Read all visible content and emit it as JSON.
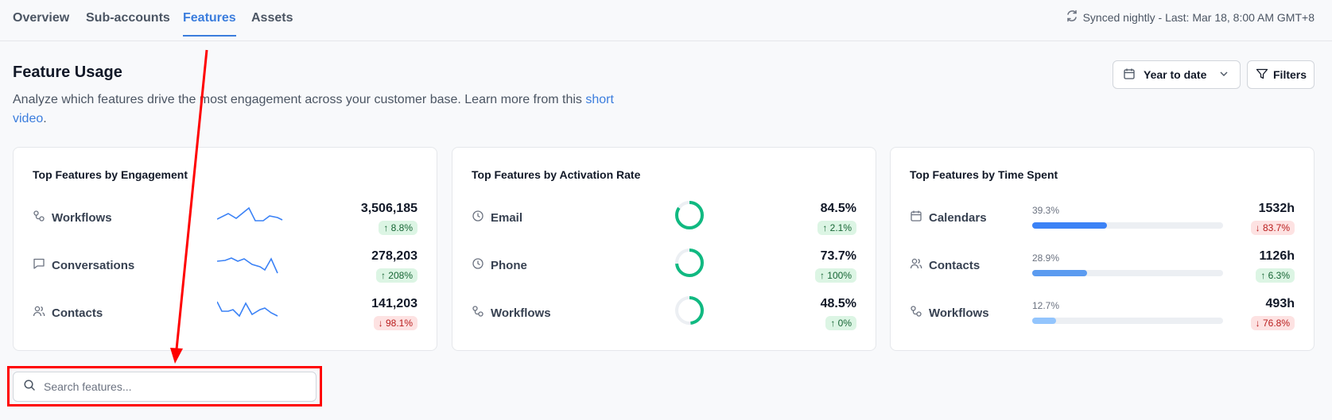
{
  "nav": {
    "tabs": [
      {
        "label": "Overview"
      },
      {
        "label": "Sub-accounts"
      },
      {
        "label": "Features"
      },
      {
        "label": "Assets"
      }
    ],
    "sync_text": "Synced nightly - Last: Mar 18, 8:00 AM GMT+8"
  },
  "header": {
    "title": "Feature Usage",
    "description": "Analyze which features drive the most engagement across your customer base. Learn more from this ",
    "link_text": "short video",
    "period": ".",
    "date_range": "Year to date",
    "filters_label": "Filters"
  },
  "cards": {
    "engagement": {
      "title": "Top Features by Engagement",
      "rows": [
        {
          "label": "Workflows",
          "icon": "workflow-icon",
          "value": "3,506,185",
          "change": "↑ 8.8%",
          "direction": "up"
        },
        {
          "label": "Conversations",
          "icon": "chat-icon",
          "value": "278,203",
          "change": "↑ 208%",
          "direction": "up"
        },
        {
          "label": "Contacts",
          "icon": "users-icon",
          "value": "141,203",
          "change": "↓ 98.1%",
          "direction": "down"
        }
      ]
    },
    "activation": {
      "title": "Top Features by Activation Rate",
      "rows": [
        {
          "label": "Email",
          "icon": "clock-icon",
          "value": "84.5%",
          "change": "↑ 2.1%",
          "direction": "up",
          "rate": 0.845
        },
        {
          "label": "Phone",
          "icon": "clock-icon",
          "value": "73.7%",
          "change": "↑ 100%",
          "direction": "up",
          "rate": 0.737
        },
        {
          "label": "Workflows",
          "icon": "workflow-icon",
          "value": "48.5%",
          "change": "↑ 0%",
          "direction": "up",
          "rate": 0.485
        }
      ]
    },
    "time_spent": {
      "title": "Top Features by Time Spent",
      "rows": [
        {
          "label": "Calendars",
          "icon": "calendar-icon",
          "share": "39.3%",
          "fraction": 0.393,
          "value": "1532h",
          "change": "↓ 83.7%",
          "direction": "down",
          "bar_color": "#3b82f6"
        },
        {
          "label": "Contacts",
          "icon": "users-icon",
          "share": "28.9%",
          "fraction": 0.289,
          "value": "1126h",
          "change": "↑ 6.3%",
          "direction": "up",
          "bar_color": "#5b9bf0"
        },
        {
          "label": "Workflows",
          "icon": "workflow-icon",
          "share": "12.7%",
          "fraction": 0.127,
          "value": "493h",
          "change": "↓ 76.8%",
          "direction": "down",
          "bar_color": "#93c5fd"
        }
      ]
    }
  },
  "search": {
    "placeholder": "Search features..."
  },
  "colors": {
    "accent": "#3b7ddd",
    "donut": "#10b981",
    "sparkline": "#3b82f6",
    "annotation": "#ff0000"
  }
}
